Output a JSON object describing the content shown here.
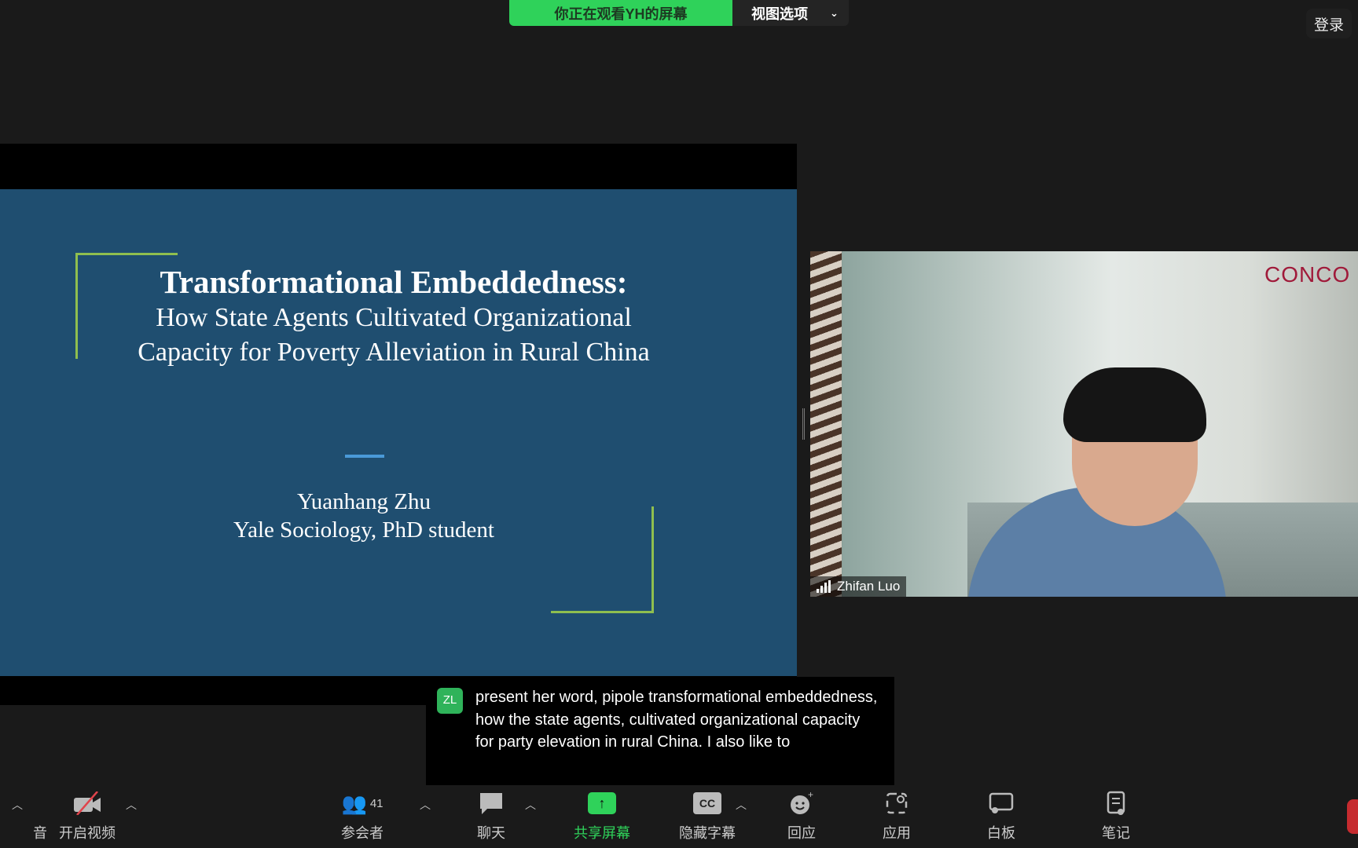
{
  "top_bar": {
    "viewing_label": "你正在观看YH的屏幕",
    "view_options_label": "视图选项",
    "login_label": "登录"
  },
  "slide": {
    "title": "Transformational Embeddedness:",
    "subtitle_line1": "How State Agents Cultivated Organizational",
    "subtitle_line2": "Capacity for Poverty Alleviation in Rural China",
    "author": "Yuanhang Zhu",
    "affiliation": "Yale Sociology, PhD student",
    "accent_color": "#8fbf4f",
    "background_color": "#1f4e70"
  },
  "video": {
    "participant_name": "Zhifan Luo",
    "background_sign": "CONCO"
  },
  "caption": {
    "initials": "ZL",
    "text": "present her word, pipole transformational embeddedness, how the state agents, cultivated organizational capacity for party elevation in rural China. I also like to"
  },
  "toolbar": {
    "audio_label": "音",
    "video_label": "开启视频",
    "participants_label": "参会者",
    "participants_count": "41",
    "chat_label": "聊天",
    "share_label": "共享屏幕",
    "captions_label": "隐藏字幕",
    "captions_icon": "CC",
    "reactions_label": "回应",
    "apps_label": "应用",
    "whiteboard_label": "白板",
    "notes_label": "笔记",
    "share_color": "#2fd25a"
  }
}
